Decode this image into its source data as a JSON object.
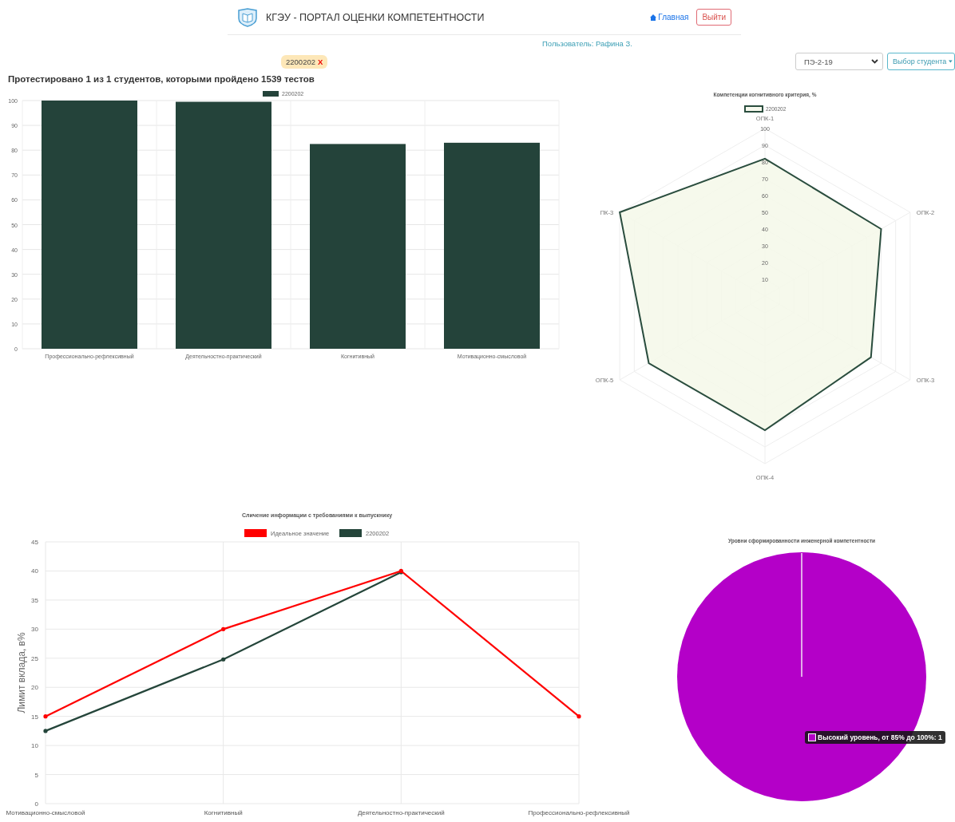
{
  "header": {
    "title": "КГЭУ - ПОРТАЛ ОЦЕНКИ КОМПЕТЕНТНОСТИ",
    "nav": [
      {
        "label": "Главная",
        "kind": "link"
      },
      {
        "label": "Выйти",
        "kind": "button"
      }
    ]
  },
  "user": "Пользователь: Рафина З.",
  "filters": {
    "tags": [
      {
        "label": "2200202",
        "remove": "X"
      }
    ],
    "group_select": {
      "value": "ПЭ-2-19"
    },
    "student_dropdown": {
      "label": "Выбор студента"
    }
  },
  "summary": "Протестировано 1 из 1 студентов, которыми пройдено 1539 тестов",
  "bar_chart": {
    "chart_data": {
      "type": "bar",
      "categories": [
        "Профессионально-рефлексивный",
        "Деятельностно-практический",
        "Когнитивный",
        "Мотивационно-смысловой"
      ],
      "series": [
        {
          "name": "2200202",
          "color": "#24433a",
          "values": [
            100,
            99.5,
            82.5,
            83
          ]
        }
      ],
      "ylim": [
        0,
        100
      ],
      "yticks": [
        0,
        10,
        20,
        30,
        40,
        50,
        60,
        70,
        80,
        90,
        100
      ],
      "grid": true,
      "legend": "top"
    }
  },
  "radar_chart": {
    "title": "Компетенции когнитивного критерия, %",
    "legend": "2200202",
    "axes": [
      "ОПК-1",
      "ОПК-2",
      "ОПК-3",
      "ОПК-4",
      "ОПК-5",
      "ПК-3"
    ],
    "ticks": [
      "100",
      "90",
      "80",
      "70",
      "60",
      "50",
      "40",
      "30",
      "20",
      "10"
    ]
  },
  "line_chart": {
    "chart_data": {
      "type": "line",
      "title": "Сличение информации с требованиями к выпускнику",
      "ylabel": "Лимит вклада, в%",
      "categories": [
        "Мотивационно-смысловой",
        "Когнитивный",
        "Деятельностно-практический",
        "Профессионально-рефлексивный"
      ],
      "series": [
        {
          "name": "Идеальное значение",
          "color": "#ff0000",
          "values": [
            15,
            30,
            40,
            15
          ]
        },
        {
          "name": "2200202",
          "color": "#24453a",
          "values": [
            12.5,
            24.8,
            39.8,
            null
          ]
        }
      ],
      "ylim": [
        0,
        45
      ],
      "yticks": [
        0,
        5,
        10,
        15,
        20,
        25,
        30,
        35,
        40,
        45
      ],
      "grid": true,
      "legend": "top"
    }
  },
  "pie_chart": {
    "title": "Уровни сформированности инженерной компетентности",
    "tooltip": {
      "text": "Высокий уровень, от 85% до 100%: 1",
      "color": "#b400c8"
    }
  }
}
